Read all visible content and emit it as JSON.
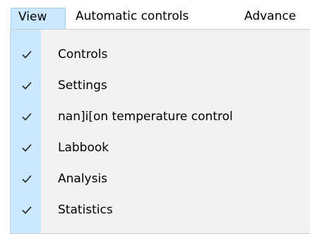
{
  "menubar": {
    "items": [
      {
        "label": "View"
      },
      {
        "label": "Automatic controls"
      },
      {
        "label": "Advance"
      }
    ]
  },
  "view_menu": {
    "items": [
      {
        "label": "Controls",
        "checked": true,
        "icon": "checkmark-icon"
      },
      {
        "label": "Settings",
        "checked": true,
        "icon": "checkmark-icon"
      },
      {
        "label": "nan]i[on temperature control",
        "checked": true,
        "icon": "checkmark-icon"
      },
      {
        "label": "Labbook",
        "checked": true,
        "icon": "checkmark-icon"
      },
      {
        "label": "Analysis",
        "checked": true,
        "icon": "checkmark-icon"
      },
      {
        "label": "Statistics",
        "checked": true,
        "icon": "checkmark-icon"
      }
    ]
  },
  "colors": {
    "selection": "#cce8ff",
    "selection_border": "#99d1ff",
    "menu_background": "#f2f2f2"
  }
}
